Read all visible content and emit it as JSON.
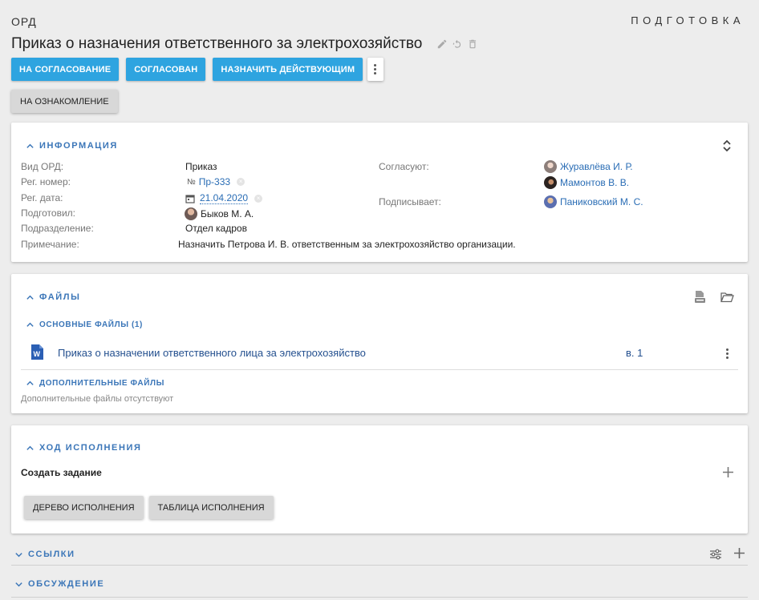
{
  "header": {
    "doc_type": "ОРД",
    "status": "ПОДГОТОВКА",
    "title": "Приказ о назначения ответственного за электрохозяйство"
  },
  "actions": {
    "send_approval": "НА СОГЛАСОВАНИЕ",
    "approved": "СОГЛАСОВАН",
    "make_active": "НАЗНАЧИТЬ ДЕЙСТВУЮЩИМ",
    "acquaint": "НА ОЗНАКОМЛЕНИЕ"
  },
  "info": {
    "heading": "ИНФОРМАЦИЯ",
    "labels": {
      "kind": "Вид ОРД:",
      "reg_number": "Рег. номер:",
      "reg_date": "Рег. дата:",
      "prepared_by": "Подготовил:",
      "department": "Подразделение:",
      "note": "Примечание:",
      "approvers": "Согласуют:",
      "signer": "Подписывает:"
    },
    "values": {
      "kind": "Приказ",
      "reg_number_prefix": "№",
      "reg_number": "Пр-333",
      "reg_date": "21.04.2020",
      "prepared_by": "Быков М. А.",
      "department": "Отдел кадров",
      "note": "Назначить Петрова И. В. ответственным за электрохозяйство организации.",
      "approvers": [
        "Журавлёва И. Р.",
        "Мамонтов В. В."
      ],
      "signer": "Паниковский М. С."
    }
  },
  "files": {
    "heading": "ФАЙЛЫ",
    "main_heading": "ОСНОВНЫЕ ФАЙЛЫ (1)",
    "main_files": [
      {
        "name": "Приказ о назначении ответственного лица за электрохозяйство",
        "version": "в. 1"
      }
    ],
    "extra_heading": "ДОПОЛНИТЕЛЬНЫЕ ФАЙЛЫ",
    "extra_empty": "Дополнительные файлы отсутствуют"
  },
  "execution": {
    "heading": "ХОД ИСПОЛНЕНИЯ",
    "create_task": "Создать задание",
    "tree_button": "ДЕРЕВО ИСПОЛНЕНИЯ",
    "table_button": "ТАБЛИЦА ИСПОЛНЕНИЯ"
  },
  "links": {
    "heading": "ССЫЛКИ"
  },
  "discussion": {
    "heading": "ОБСУЖДЕНИЕ"
  },
  "colors": {
    "accent": "#2ea4e0",
    "link": "#2a6db5",
    "section": "#3b76b8"
  }
}
